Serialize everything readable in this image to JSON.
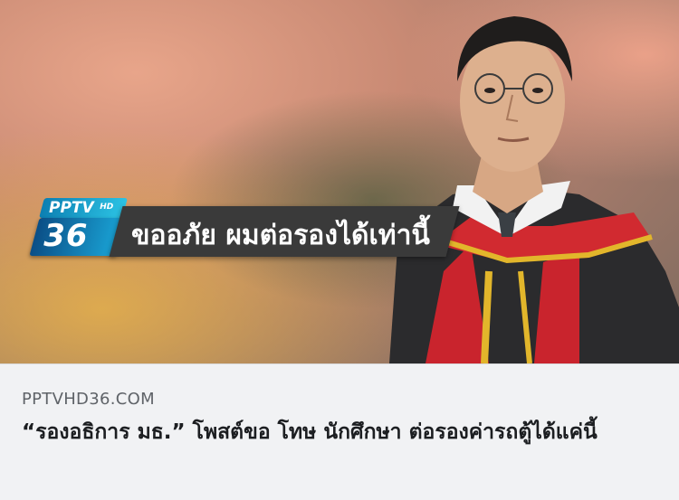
{
  "link_preview": {
    "image": {
      "logo": {
        "top": "PPTV",
        "hd": "HD",
        "channel": "36"
      },
      "banner_text": "ขออภัย ผมต่อรองได้เท่านี้"
    },
    "domain": "PPTVHD36.COM",
    "headline": "“รองอธิการ มธ.” โพสต์ขอ โทษ นักศึกษา ต่อรองค่ารถตู้ได้แค่นี้"
  }
}
